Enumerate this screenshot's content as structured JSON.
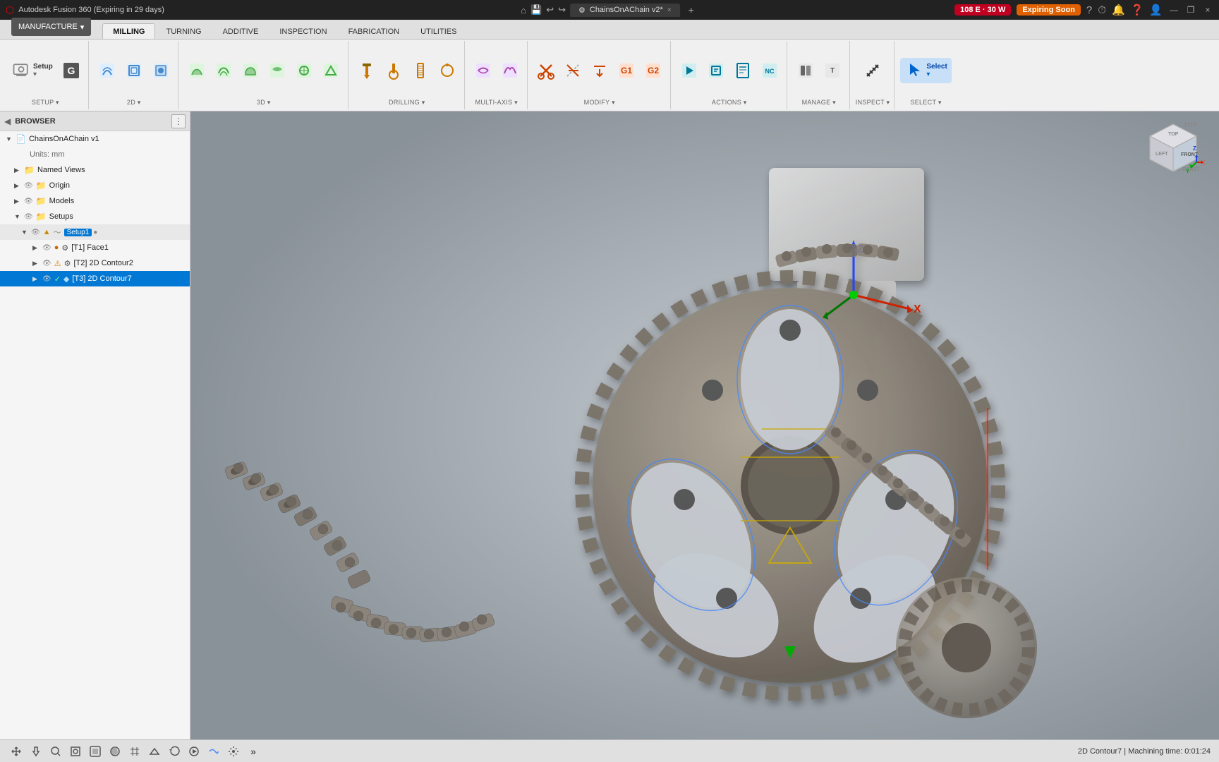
{
  "titlebar": {
    "app_name": "Autodesk Fusion 360 (Expiring in 29 days)",
    "file_tab": "ChainsOnAChain v2*",
    "close_label": "×",
    "plus_label": "+",
    "win_buttons": [
      "—",
      "❐",
      "×"
    ]
  },
  "toolbar": {
    "manufacture_label": "MANUFACTURE",
    "manufacture_arrow": "▾",
    "tabs": [
      "MILLING",
      "TURNING",
      "ADDITIVE",
      "INSPECTION",
      "FABRICATION",
      "UTILITIES"
    ],
    "active_tab": "MILLING",
    "groups": {
      "setup": {
        "label": "SETUP",
        "buttons": [
          "Setup ▾"
        ]
      },
      "2d": {
        "label": "2D",
        "buttons": [
          "2D ▾"
        ]
      },
      "3d": {
        "label": "3D",
        "buttons": [
          "3D ▾"
        ]
      },
      "drilling": {
        "label": "DRILLING",
        "buttons": [
          "Drilling ▾"
        ]
      },
      "multi_axis": {
        "label": "MULTI-AXIS",
        "buttons": [
          "Multi-Axis ▾"
        ]
      },
      "modify": {
        "label": "MODIFY",
        "buttons": [
          "Modify ▾"
        ]
      },
      "actions": {
        "label": "ACTIONS",
        "buttons": [
          "Actions ▾"
        ]
      },
      "manage": {
        "label": "MANAGE",
        "buttons": [
          "Manage ▾"
        ]
      },
      "inspect": {
        "label": "INSPECT",
        "buttons": [
          "Inspect ▾"
        ]
      },
      "select": {
        "label": "SELECT",
        "buttons": [
          "Select ▾"
        ]
      }
    }
  },
  "browser": {
    "title": "BROWSER",
    "root": {
      "label": "ChainsOnAChain v1",
      "items": [
        {
          "id": "units",
          "label": "Units: mm",
          "indent": 2,
          "chevron": false
        },
        {
          "id": "named-views",
          "label": "Named Views",
          "indent": 1,
          "chevron": "▶",
          "folder": true
        },
        {
          "id": "origin",
          "label": "Origin",
          "indent": 1,
          "chevron": "▶",
          "folder": false
        },
        {
          "id": "models",
          "label": "Models",
          "indent": 1,
          "chevron": "▶",
          "folder": false
        },
        {
          "id": "setups",
          "label": "Setups",
          "indent": 1,
          "chevron": "▼",
          "folder": false
        },
        {
          "id": "setup1",
          "label": "Setup1",
          "indent": 2,
          "chevron": "▼",
          "tag": "Setup1",
          "active": true
        },
        {
          "id": "t1",
          "label": "[T1] Face1",
          "indent": 3,
          "chevron": "▶",
          "status": "orange"
        },
        {
          "id": "t2",
          "label": "[T2] 2D Contour2",
          "indent": 3,
          "chevron": "▶",
          "status": "warning"
        },
        {
          "id": "t3",
          "label": "[T3] 2D Contour7",
          "indent": 3,
          "chevron": "▶",
          "status": "check",
          "selected": true
        }
      ]
    }
  },
  "header_pills": {
    "power": "108 E · 30 W",
    "expiry": "Expiring Soon"
  },
  "statusbar": {
    "status_text": "2D Contour7 | Machining time: 0:01:24"
  },
  "view_cube": {
    "top": "TOP",
    "left": "LEFT",
    "front": "FRONT"
  }
}
